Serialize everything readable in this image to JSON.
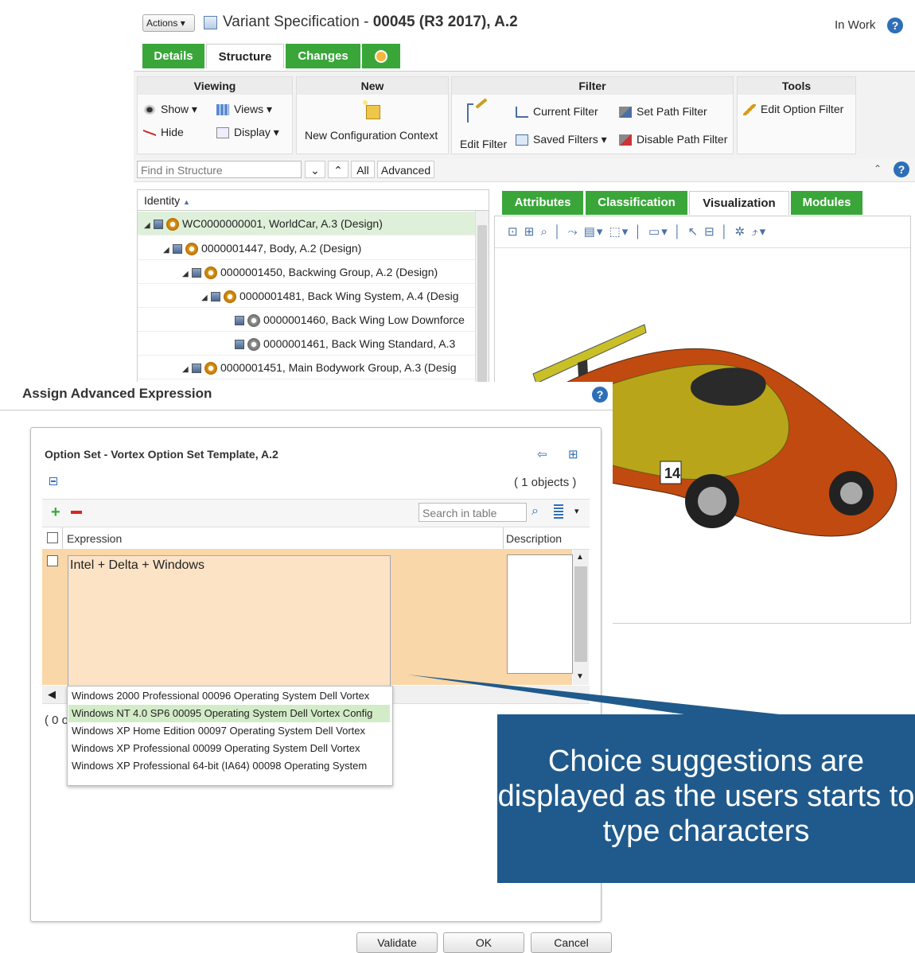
{
  "header": {
    "actions_label": "Actions",
    "title_prefix": "Variant Specification - ",
    "title_bold": "00045 (R3 2017), A.2",
    "status": "In Work"
  },
  "tabs": [
    "Details",
    "Structure",
    "Changes"
  ],
  "ribbon": {
    "viewing": {
      "title": "Viewing",
      "show": "Show",
      "hide": "Hide",
      "views": "Views",
      "display": "Display"
    },
    "new": {
      "title": "New",
      "new_config": "New Configuration Context"
    },
    "filter": {
      "title": "Filter",
      "edit_filter": "Edit Filter",
      "current_filter": "Current Filter",
      "saved_filters": "Saved Filters",
      "set_path_filter": "Set Path Filter",
      "disable_path_filter": "Disable Path Filter"
    },
    "tools": {
      "title": "Tools",
      "edit_option_filter": "Edit Option Filter"
    }
  },
  "findbar": {
    "placeholder": "Find in Structure",
    "all": "All",
    "advanced": "Advanced"
  },
  "tree": {
    "header": "Identity",
    "rows": [
      "WC0000000001, WorldCar, A.3 (Design)",
      "0000001447, Body, A.2 (Design)",
      "0000001450, Backwing Group, A.2 (Design)",
      "0000001481, Back Wing System, A.4 (Desig",
      "0000001460, Back Wing Low Downforce",
      "0000001461, Back Wing Standard, A.3",
      "0000001451, Main Bodywork Group, A.3 (Desig"
    ]
  },
  "right_tabs": [
    "Attributes",
    "Classification",
    "Visualization",
    "Modules"
  ],
  "dialog": {
    "title": "Assign Advanced Expression",
    "panel_title": "Option Set - Vortex Option Set Template, A.2",
    "objects_count": "( 1 objects )",
    "search_placeholder": "Search in table",
    "col_expression": "Expression",
    "col_description": "Description",
    "expression_value": "Intel + Delta + Windows",
    "suggestions": [
      "Windows 2000 Professional 00096 Operating System Dell Vortex",
      "Windows NT 4.0 SP6 00095 Operating System Dell Vortex Config",
      "Windows XP Home Edition 00097 Operating System Dell Vortex",
      "Windows XP Professional 00099 Operating System Dell Vortex",
      "Windows XP Professional 64-bit (IA64) 00098 Operating System"
    ],
    "footer_count": "( 0 o",
    "validate": "Validate",
    "ok": "OK",
    "cancel": "Cancel"
  },
  "callout": "Choice suggestions are displayed as the users starts to type characters",
  "colors": {
    "green_tab": "#3aa63a",
    "callout": "#205a8c",
    "row_highlight": "#fad7a8"
  }
}
